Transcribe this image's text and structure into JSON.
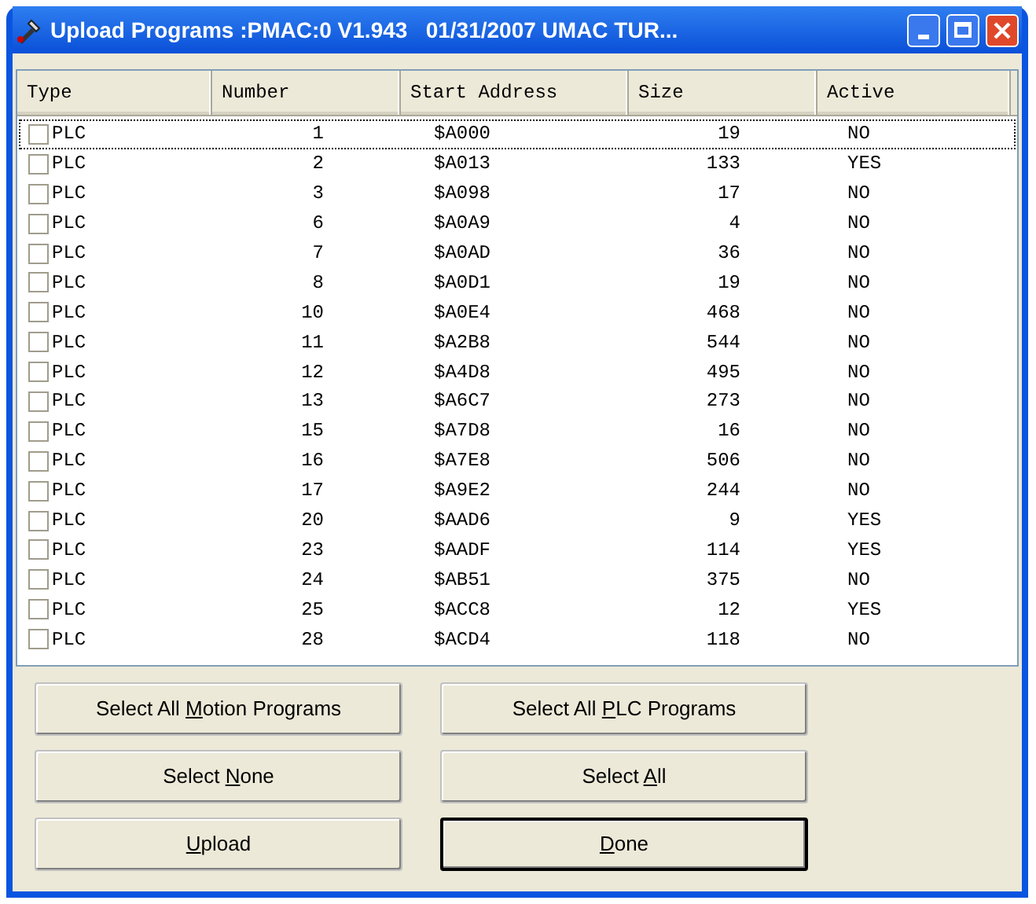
{
  "window": {
    "title": "Upload Programs :PMAC:0 V1.943   01/31/2007 UMAC TUR..."
  },
  "table": {
    "columns": [
      {
        "label": "Type"
      },
      {
        "label": "Number"
      },
      {
        "label": "Start Address"
      },
      {
        "label": "Size"
      },
      {
        "label": "Active"
      }
    ],
    "rows": [
      {
        "checked": false,
        "focused": true,
        "cells": [
          "PLC",
          "1",
          "$A000",
          "19",
          "NO"
        ]
      },
      {
        "checked": false,
        "focused": false,
        "cells": [
          "PLC",
          "2",
          "$A013",
          "133",
          "YES"
        ]
      },
      {
        "checked": false,
        "focused": false,
        "cells": [
          "PLC",
          "3",
          "$A098",
          "17",
          "NO"
        ]
      },
      {
        "checked": false,
        "focused": false,
        "cells": [
          "PLC",
          "6",
          "$A0A9",
          "4",
          "NO"
        ]
      },
      {
        "checked": false,
        "focused": false,
        "cells": [
          "PLC",
          "7",
          "$A0AD",
          "36",
          "NO"
        ]
      },
      {
        "checked": false,
        "focused": false,
        "cells": [
          "PLC",
          "8",
          "$A0D1",
          "19",
          "NO"
        ]
      },
      {
        "checked": false,
        "focused": false,
        "cells": [
          "PLC",
          "10",
          "$A0E4",
          "468",
          "NO"
        ]
      },
      {
        "checked": false,
        "focused": false,
        "cells": [
          "PLC",
          "11",
          "$A2B8",
          "544",
          "NO"
        ]
      },
      {
        "checked": false,
        "focused": false,
        "cells": [
          "PLC",
          "12",
          "$A4D8",
          "495",
          "NO"
        ]
      },
      {
        "checked": false,
        "focused": false,
        "cells": [
          "PLC",
          "13",
          "$A6C7",
          "273",
          "NO"
        ]
      },
      {
        "checked": false,
        "focused": false,
        "cells": [
          "PLC",
          "15",
          "$A7D8",
          "16",
          "NO"
        ]
      },
      {
        "checked": false,
        "focused": false,
        "cells": [
          "PLC",
          "16",
          "$A7E8",
          "506",
          "NO"
        ]
      },
      {
        "checked": false,
        "focused": false,
        "cells": [
          "PLC",
          "17",
          "$A9E2",
          "244",
          "NO"
        ]
      },
      {
        "checked": false,
        "focused": false,
        "cells": [
          "PLC",
          "20",
          "$AAD6",
          "9",
          "YES"
        ]
      },
      {
        "checked": false,
        "focused": false,
        "cells": [
          "PLC",
          "23",
          "$AADF",
          "114",
          "YES"
        ]
      },
      {
        "checked": false,
        "focused": false,
        "cells": [
          "PLC",
          "24",
          "$AB51",
          "375",
          "NO"
        ]
      },
      {
        "checked": false,
        "focused": false,
        "cells": [
          "PLC",
          "25",
          "$ACC8",
          "12",
          "YES"
        ]
      },
      {
        "checked": false,
        "focused": false,
        "cells": [
          "PLC",
          "28",
          "$ACD4",
          "118",
          "NO"
        ]
      }
    ]
  },
  "buttons": [
    {
      "before": "Select All ",
      "key": "M",
      "after": "otion Programs",
      "default": false
    },
    {
      "before": "Select All ",
      "key": "P",
      "after": "LC Programs",
      "default": false
    },
    {
      "before": "Select ",
      "key": "N",
      "after": "one",
      "default": false
    },
    {
      "before": "Select ",
      "key": "A",
      "after": "ll",
      "default": false
    },
    {
      "key": "U",
      "after": "pload",
      "default": false
    },
    {
      "key": "D",
      "after": "one",
      "default": true
    }
  ]
}
